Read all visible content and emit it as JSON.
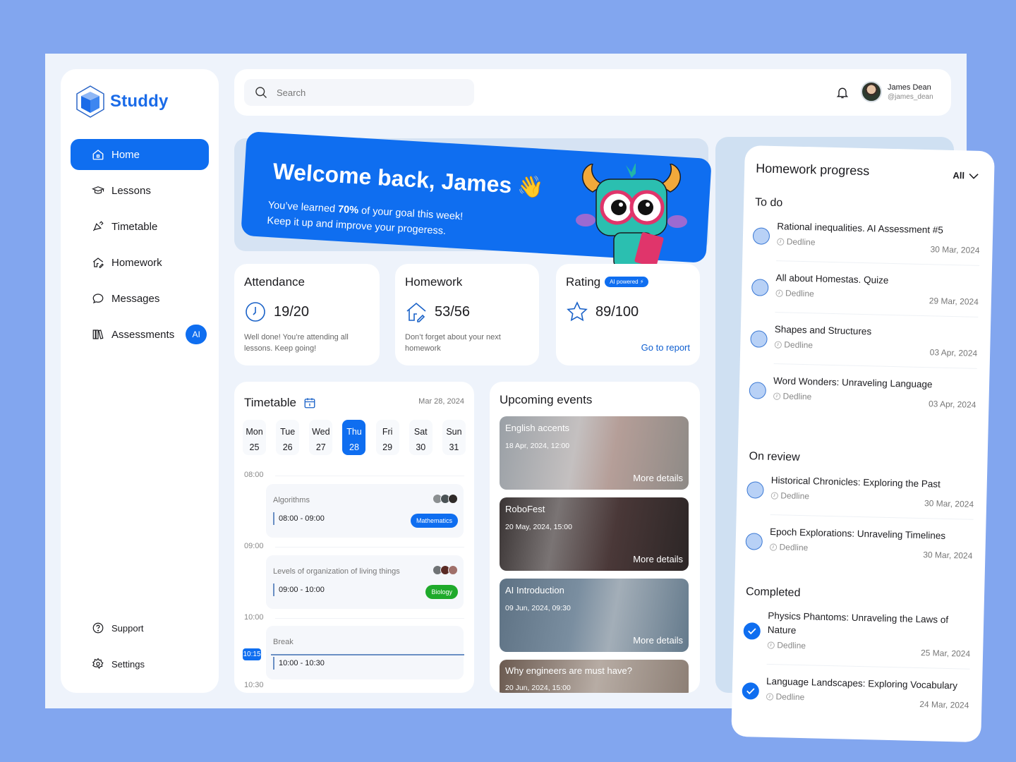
{
  "brand": {
    "name": "Studdy"
  },
  "sidebar": {
    "items": [
      {
        "label": "Home",
        "icon": "home-icon",
        "active": true
      },
      {
        "label": "Lessons",
        "icon": "graduation-cap-icon"
      },
      {
        "label": "Timetable",
        "icon": "bell-pen-icon"
      },
      {
        "label": "Homework",
        "icon": "house-pen-icon"
      },
      {
        "label": "Messages",
        "icon": "chat-bubble-icon"
      },
      {
        "label": "Assessments",
        "icon": "books-icon",
        "badge": "AI"
      }
    ],
    "bottom": [
      {
        "label": "Support",
        "icon": "help-circle-icon"
      },
      {
        "label": "Settings",
        "icon": "gear-icon"
      }
    ]
  },
  "topbar": {
    "search_placeholder": "Search",
    "user": {
      "name": "James Dean",
      "handle": "@james_dean"
    }
  },
  "banner": {
    "title": "Welcome back, James",
    "emoji": "👋",
    "line1_pre": "You’ve learned",
    "line1_pct": "70%",
    "line1_post": " of your goal this week!",
    "line2": "Keep it up and improve your progeress.",
    "progress_percent": 70
  },
  "stats": {
    "attendance": {
      "title": "Attendance",
      "value": "19/20",
      "desc": "Well done! You’re attending all lessons. Keep going!"
    },
    "homework": {
      "title": "Homework",
      "value": "53/56",
      "desc": "Don’t forget about your next homework"
    },
    "rating": {
      "title": "Rating",
      "badge": "AI powered ⚡",
      "value": "89/100",
      "link": "Go to report"
    }
  },
  "timetable": {
    "title": "Timetable",
    "date": "Mar 28, 2024",
    "days": [
      {
        "name": "Mon",
        "num": "25"
      },
      {
        "name": "Tue",
        "num": "26"
      },
      {
        "name": "Wed",
        "num": "27"
      },
      {
        "name": "Thu",
        "num": "28",
        "active": true
      },
      {
        "name": "Fri",
        "num": "29"
      },
      {
        "name": "Sat",
        "num": "30"
      },
      {
        "name": "Sun",
        "num": "31"
      }
    ],
    "hours": [
      "08:00",
      "09:00",
      "10:00",
      "10:30"
    ],
    "lessons": [
      {
        "name": "Algorithms",
        "time": "08:00 - 09:00",
        "subject": "Mathematics",
        "color": "#0f6ef0"
      },
      {
        "name": "Levels of organization of living things",
        "time": "09:00 - 10:00",
        "subject": "Biology",
        "color": "#1faa2b"
      },
      {
        "name": "Break",
        "time": "10:00 - 10:30"
      }
    ],
    "now": "10:15"
  },
  "events": {
    "title": "Upcoming events",
    "more_label": "More details",
    "items": [
      {
        "name": "English accents",
        "date": "18 Apr, 2024, 12:00"
      },
      {
        "name": "RoboFest",
        "date": "20 May, 2024, 15:00"
      },
      {
        "name": "AI Introduction",
        "date": "09 Jun, 2024, 09:30"
      },
      {
        "name": "Why engineers are must have?",
        "date": "20 Jun, 2024, 15:00"
      }
    ]
  },
  "homework_progress": {
    "title": "Homework progress",
    "filter": "All",
    "deadline_label": "Dedline",
    "sections": [
      {
        "title": "To do",
        "items": [
          {
            "name": "Rational inequalities. AI Assessment #5",
            "date": "30 Mar, 2024"
          },
          {
            "name": "All about Homestas. Quize",
            "date": "29 Mar, 2024"
          },
          {
            "name": "Shapes and Structures",
            "date": "03 Apr, 2024"
          },
          {
            "name": "Word Wonders: Unraveling Language",
            "date": "03 Apr, 2024"
          }
        ]
      },
      {
        "title": "On review",
        "items": [
          {
            "name": "Historical Chronicles: Exploring the Past",
            "date": "30 Mar, 2024"
          },
          {
            "name": "Epoch Explorations: Unraveling Timelines",
            "date": "30 Mar, 2024"
          }
        ]
      },
      {
        "title": "Completed",
        "items": [
          {
            "name": "Physics Phantoms: Unraveling the Laws of Nature",
            "date": "25 Mar, 2024",
            "done": true
          },
          {
            "name": "Language Landscapes: Exploring Vocabulary",
            "date": "24 Mar, 2024",
            "done": true
          }
        ]
      }
    ]
  },
  "colors": {
    "accent": "#0f6ef0",
    "background": "#82a6ef",
    "panel": "#eef3fb",
    "biology": "#1faa2b"
  }
}
